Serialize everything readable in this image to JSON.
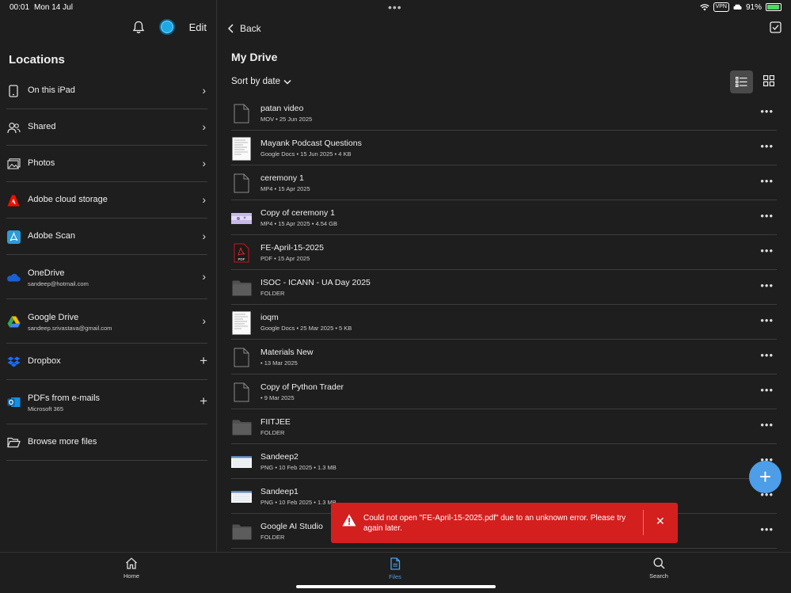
{
  "status_bar": {
    "time": "00:01",
    "date": "Mon 14 Jul",
    "vpn": "VPN",
    "battery": "91%",
    "battery_level": 0.91
  },
  "sidebar": {
    "edit_label": "Edit",
    "title": "Locations",
    "items": [
      {
        "label": "On this iPad",
        "sub": "",
        "icon": "ipad-icon",
        "action": "chevron"
      },
      {
        "label": "Shared",
        "sub": "",
        "icon": "people-icon",
        "action": "chevron"
      },
      {
        "label": "Photos",
        "sub": "",
        "icon": "photos-icon",
        "action": "chevron"
      },
      {
        "label": "Adobe cloud storage",
        "sub": "",
        "icon": "adobe-icon",
        "action": "chevron"
      },
      {
        "label": "Adobe Scan",
        "sub": "",
        "icon": "adobe-scan-icon",
        "action": "chevron"
      },
      {
        "label": "OneDrive",
        "sub": "sandeep@hotmail.com",
        "icon": "onedrive-icon",
        "action": "chevron"
      },
      {
        "label": "Google Drive",
        "sub": "sandeep.srivastava@gmail.com",
        "icon": "google-drive-icon",
        "action": "chevron"
      },
      {
        "label": "Dropbox",
        "sub": "",
        "icon": "dropbox-icon",
        "action": "plus"
      },
      {
        "label": "PDFs from e-mails",
        "sub": "Microsoft 365",
        "icon": "outlook-icon",
        "action": "plus"
      },
      {
        "label": "Browse more files",
        "sub": "",
        "icon": "folder-open-icon",
        "action": "none"
      }
    ]
  },
  "main": {
    "back_label": "Back",
    "title": "My Drive",
    "sort_label": "Sort by date",
    "files": [
      {
        "name": "patan video",
        "meta": "MOV  •  25 Jun 2025",
        "thumb": "doc"
      },
      {
        "name": "Mayank Podcast Questions",
        "meta": "Google Docs  •  15 Jun 2025  •  4 KB",
        "thumb": "gdoc"
      },
      {
        "name": "ceremony 1",
        "meta": "MP4  •  15 Apr 2025",
        "thumb": "doc"
      },
      {
        "name": "Copy of ceremony 1",
        "meta": "MP4  •  15 Apr 2025  •  4.54 GB",
        "thumb": "video"
      },
      {
        "name": "FE-April-15-2025",
        "meta": "PDF  •  15 Apr 2025",
        "thumb": "pdf"
      },
      {
        "name": "ISOC - ICANN - UA Day 2025",
        "meta": "FOLDER",
        "thumb": "folder"
      },
      {
        "name": "ioqm",
        "meta": "Google Docs  •  25 Mar 2025  •  5 KB",
        "thumb": "gdoc"
      },
      {
        "name": "Materials New",
        "meta": "  •  13 Mar 2025",
        "thumb": "doc"
      },
      {
        "name": "Copy of Python Trader",
        "meta": "  •  9 Mar 2025",
        "thumb": "doc"
      },
      {
        "name": "FIITJEE",
        "meta": "FOLDER",
        "thumb": "folder"
      },
      {
        "name": "Sandeep2",
        "meta": "PNG  •  10 Feb 2025  •  1.3 MB",
        "thumb": "png"
      },
      {
        "name": "Sandeep1",
        "meta": "PNG  •  10 Feb 2025  •  1.3 MB",
        "thumb": "png"
      },
      {
        "name": "Google AI Studio",
        "meta": "FOLDER",
        "thumb": "folder"
      }
    ]
  },
  "toast": {
    "message": "Could not open \"FE-April-15-2025.pdf\" due to an unknown error. Please try again later."
  },
  "tabbar": {
    "tabs": [
      {
        "label": "Home",
        "active": false
      },
      {
        "label": "Files",
        "active": true
      },
      {
        "label": "Search",
        "active": false
      }
    ]
  },
  "colors": {
    "background": "#1e1e1e",
    "accent": "#4c9ee8",
    "error": "#d41f1f",
    "divider": "#3d3d3d"
  }
}
